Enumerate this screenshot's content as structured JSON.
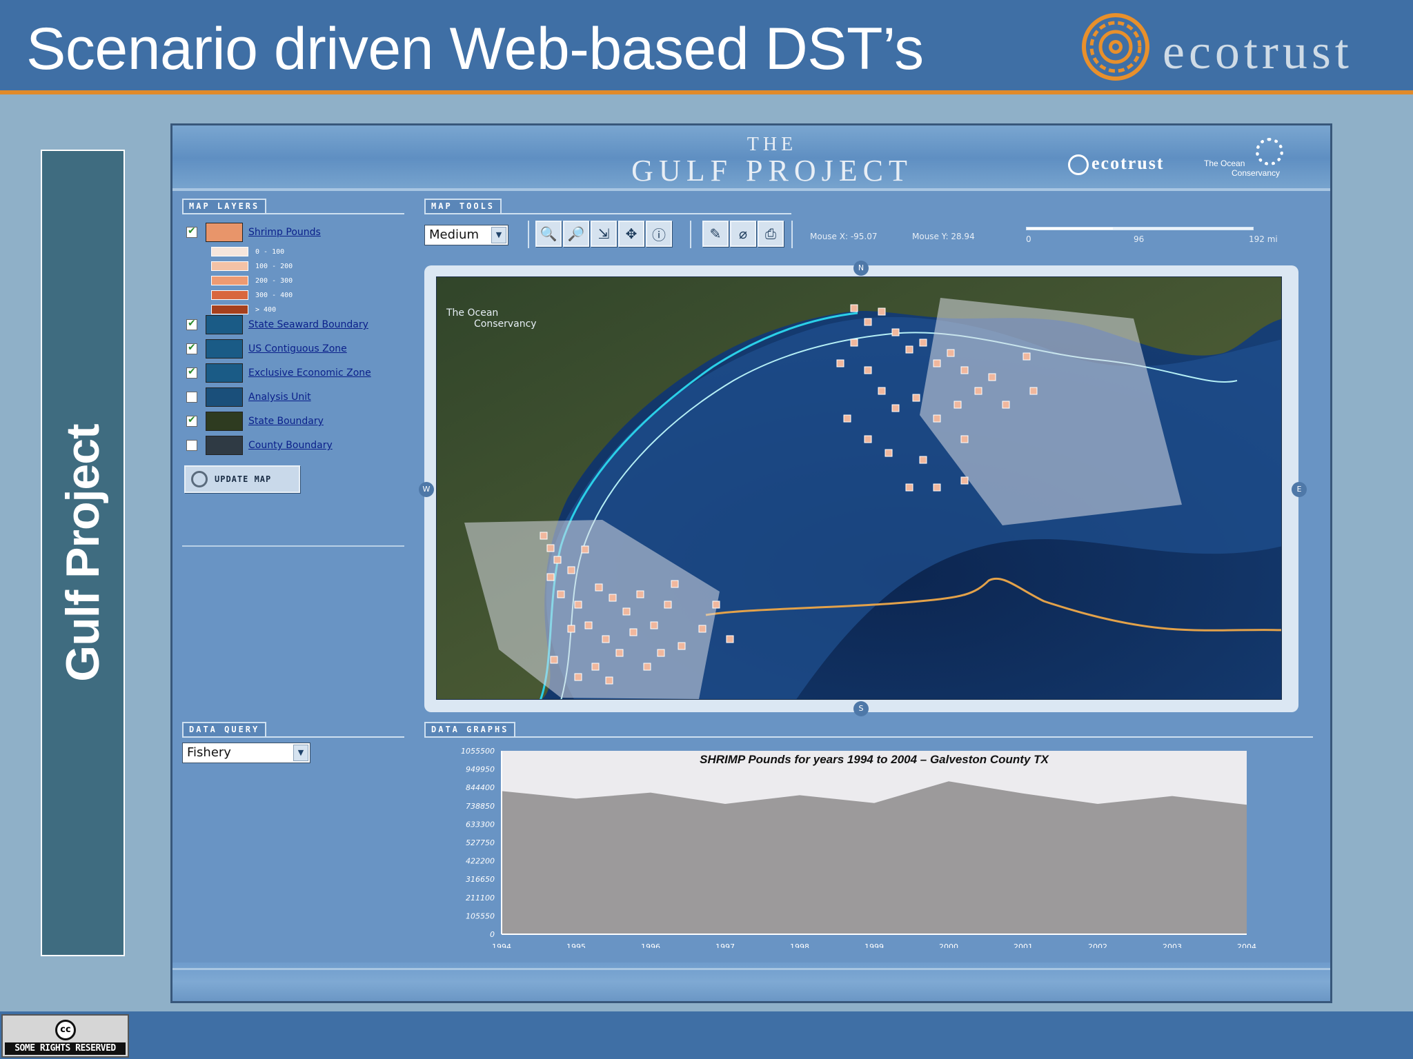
{
  "slide": {
    "title": "Scenario driven Web-based DST’s",
    "logo_text": "ecotrust",
    "side_label": "Gulf Project",
    "license_text": "SOME RIGHTS RESERVED",
    "license_icon": "cc-icon"
  },
  "app": {
    "title_small": "THE",
    "title_big": "GULF PROJECT",
    "header_logo_ecotrust": "ecotrust",
    "header_logo_toc_line1": "The Ocean",
    "header_logo_toc_line2": "Conservancy"
  },
  "map_layers": {
    "tab_label": "MAP LAYERS",
    "layers": [
      {
        "name": "Shrimp Pounds",
        "checked": true,
        "swatch_color": "#e8956a"
      },
      {
        "name": "State Seaward Boundary",
        "checked": true,
        "swatch_color": "#1a5b86"
      },
      {
        "name": "US Contiguous Zone",
        "checked": true,
        "swatch_color": "#1a5b86"
      },
      {
        "name": "Exclusive Economic Zone",
        "checked": true,
        "swatch_color": "#1a5b86"
      },
      {
        "name": "Analysis Unit",
        "checked": false,
        "swatch_color": "#1a4f7a"
      },
      {
        "name": "State Boundary",
        "checked": true,
        "swatch_color": "#2e3b20"
      },
      {
        "name": "County Boundary",
        "checked": false,
        "swatch_color": "#2f3a44"
      }
    ],
    "legend": [
      {
        "label": "0 - 100",
        "color": "#f6e6dc"
      },
      {
        "label": "100 - 200",
        "color": "#f3c2a6"
      },
      {
        "label": "200 - 300",
        "color": "#ee9a72"
      },
      {
        "label": "300 - 400",
        "color": "#d8673e"
      },
      {
        "label": "> 400",
        "color": "#a5401e"
      }
    ],
    "update_button": "UPDATE MAP",
    "update_icon": "refresh-icon"
  },
  "map_tools": {
    "tab_label": "MAP TOOLS",
    "size_select": "Medium",
    "tools": [
      {
        "icon": "zoom-in-icon",
        "glyph": "🔍"
      },
      {
        "icon": "zoom-out-icon",
        "glyph": "🔎"
      },
      {
        "icon": "zoom-extent-icon",
        "glyph": "⇲"
      },
      {
        "icon": "pan-icon",
        "glyph": "✥"
      },
      {
        "icon": "identify-icon",
        "glyph": "ⓘ"
      },
      {
        "icon": "draw-tool-icon",
        "glyph": "✎"
      },
      {
        "icon": "select-tool-icon",
        "glyph": "⌀"
      },
      {
        "icon": "export-icon",
        "glyph": "⎙"
      }
    ],
    "mouse_x": "Mouse X: -95.07",
    "mouse_y": "Mouse Y: 28.94",
    "scale_fill": 0.38,
    "scale_ticks": [
      "0",
      "96",
      "192 mi"
    ]
  },
  "map": {
    "pan_north": "N",
    "pan_south": "S",
    "pan_west": "W",
    "pan_east": "E",
    "watermark_line1": "The Ocean",
    "watermark_line2": "Conservancy"
  },
  "data_query": {
    "tab_label": "DATA QUERY",
    "select_value": "Fishery"
  },
  "data_graphs": {
    "tab_label": "DATA GRAPHS"
  },
  "chart_data": {
    "type": "area",
    "title": "SHRIMP Pounds for years 1994 to 2004 – Galveston County TX",
    "categories": [
      "1994",
      "1995",
      "1996",
      "1997",
      "1998",
      "1999",
      "2000",
      "2001",
      "2002",
      "2003",
      "2004"
    ],
    "values": [
      824000,
      780000,
      815000,
      750000,
      800000,
      755000,
      880000,
      810000,
      750000,
      795000,
      745000
    ],
    "ytick_labels": [
      "1055500",
      "949950",
      "844400",
      "738850",
      "633300",
      "527750",
      "422200",
      "316650",
      "211100",
      "105550",
      "0"
    ],
    "ylim": [
      0,
      1055500
    ],
    "series_color": "#9c9a9b",
    "background_color": "#ecebee"
  }
}
